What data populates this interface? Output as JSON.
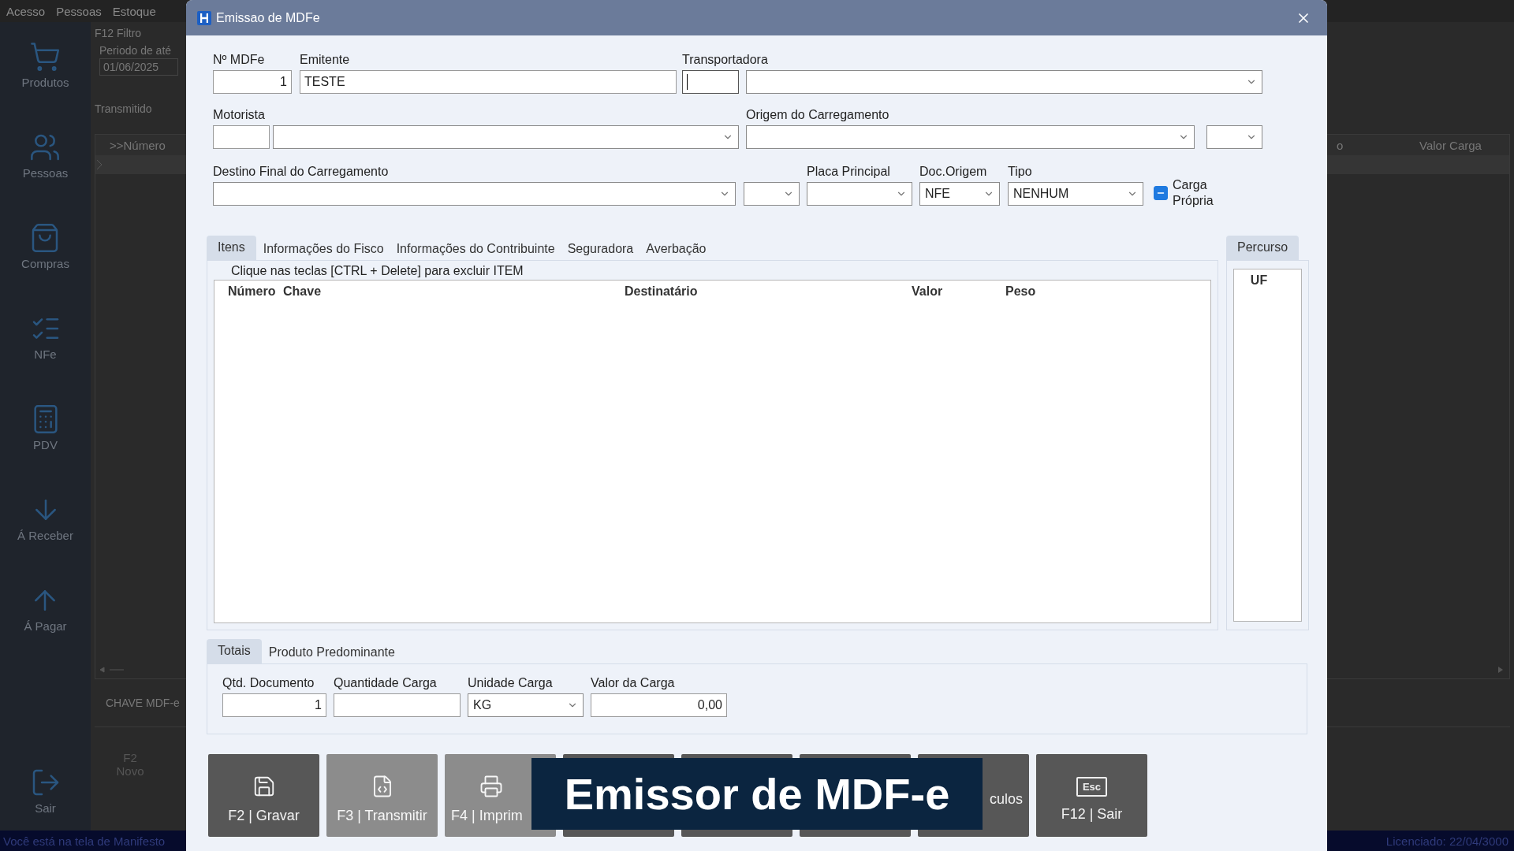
{
  "background": {
    "menu": [
      "Acesso",
      "Pessoas",
      "Estoque"
    ],
    "sidebar": [
      {
        "kind": "cart",
        "label": "Produtos"
      },
      {
        "kind": "people",
        "label": "Pessoas"
      },
      {
        "kind": "bag",
        "label": "Compras"
      },
      {
        "kind": "checklist",
        "label": "NFe"
      },
      {
        "kind": "terminal",
        "label": "PDV"
      },
      {
        "kind": "down",
        "label": "Á Receber"
      },
      {
        "kind": "up",
        "label": "Á Pagar"
      },
      {
        "kind": "exit",
        "label": "Sair"
      }
    ],
    "filter": {
      "title": "F12 Filtro",
      "period_label": "Periodo de até",
      "date": "01/06/2025"
    },
    "tab": "Transmitido",
    "grid": {
      "first_column": ">>Número",
      "right_columns": [
        "o",
        "Valor Carga"
      ]
    },
    "key_label": "CHAVE MDF-e",
    "new_button": {
      "key": "F2",
      "label": "Novo"
    },
    "status_left": "Você está na tela de Manifesto",
    "status_right": "Licenciado: 22/04/3000"
  },
  "dialog": {
    "title": "Emissao de MDFe",
    "numero": {
      "label": "Nº MDFe",
      "value": "1"
    },
    "emitente": {
      "label": "Emitente",
      "value": "TESTE"
    },
    "transportadora": {
      "label": "Transportadora",
      "focused": true
    },
    "motorista": {
      "label": "Motorista"
    },
    "origem": {
      "label": "Origem do Carregamento"
    },
    "destino": {
      "label": "Destino Final do Carregamento"
    },
    "placa": {
      "label": "Placa Principal"
    },
    "doc_origem": {
      "label": "Doc.Origem",
      "value": "NFE"
    },
    "tipo": {
      "label": "Tipo",
      "value": "NENHUM"
    },
    "carga_propria": {
      "label": "Carga Própria",
      "indeterminate": true
    },
    "tabs": [
      {
        "label": "Itens",
        "selected": true
      },
      {
        "label": "Informações do Fisco",
        "selected": false
      },
      {
        "label": "Informações do Contribuinte",
        "selected": false
      },
      {
        "label": "Seguradora",
        "selected": false
      },
      {
        "label": "Averbação",
        "selected": false
      }
    ],
    "items_hint": "Clique nas teclas [CTRL + Delete] para excluir ITEM",
    "items_columns": [
      "Número",
      "Chave",
      "Destinatário",
      "Valor",
      "Peso"
    ],
    "route_tab": {
      "label": "Percurso",
      "selected": true
    },
    "route_columns": [
      "UF"
    ],
    "totals_tabs": [
      {
        "label": "Totais",
        "selected": true
      },
      {
        "label": "Produto Predominante",
        "selected": false
      }
    ],
    "totals": {
      "qtd": {
        "label": "Qtd. Documento",
        "value": "1"
      },
      "quantidade": {
        "label": "Quantidade Carga"
      },
      "unidade": {
        "label": "Unidade Carga",
        "value": "KG"
      },
      "valor": {
        "label": "Valor da Carga",
        "value": "0,00"
      }
    },
    "buttons": [
      {
        "kind": "save",
        "label": "F2 | Gravar",
        "disabled": false
      },
      {
        "kind": "transmit",
        "label": "F3 | Transmitir",
        "disabled": true
      },
      {
        "kind": "print",
        "label": "F4 | Imprim",
        "disabled": true
      },
      {
        "kind": "plain",
        "disabled": false
      },
      {
        "kind": "plain",
        "disabled": false
      },
      {
        "kind": "plain",
        "disabled": false
      },
      {
        "kind": "cut",
        "label": "culos",
        "disabled": false
      },
      {
        "kind": "exit",
        "label": "F12 | Sair",
        "key_label": "Esc",
        "disabled": false
      }
    ]
  },
  "caption": "Emissor de MDF-e"
}
